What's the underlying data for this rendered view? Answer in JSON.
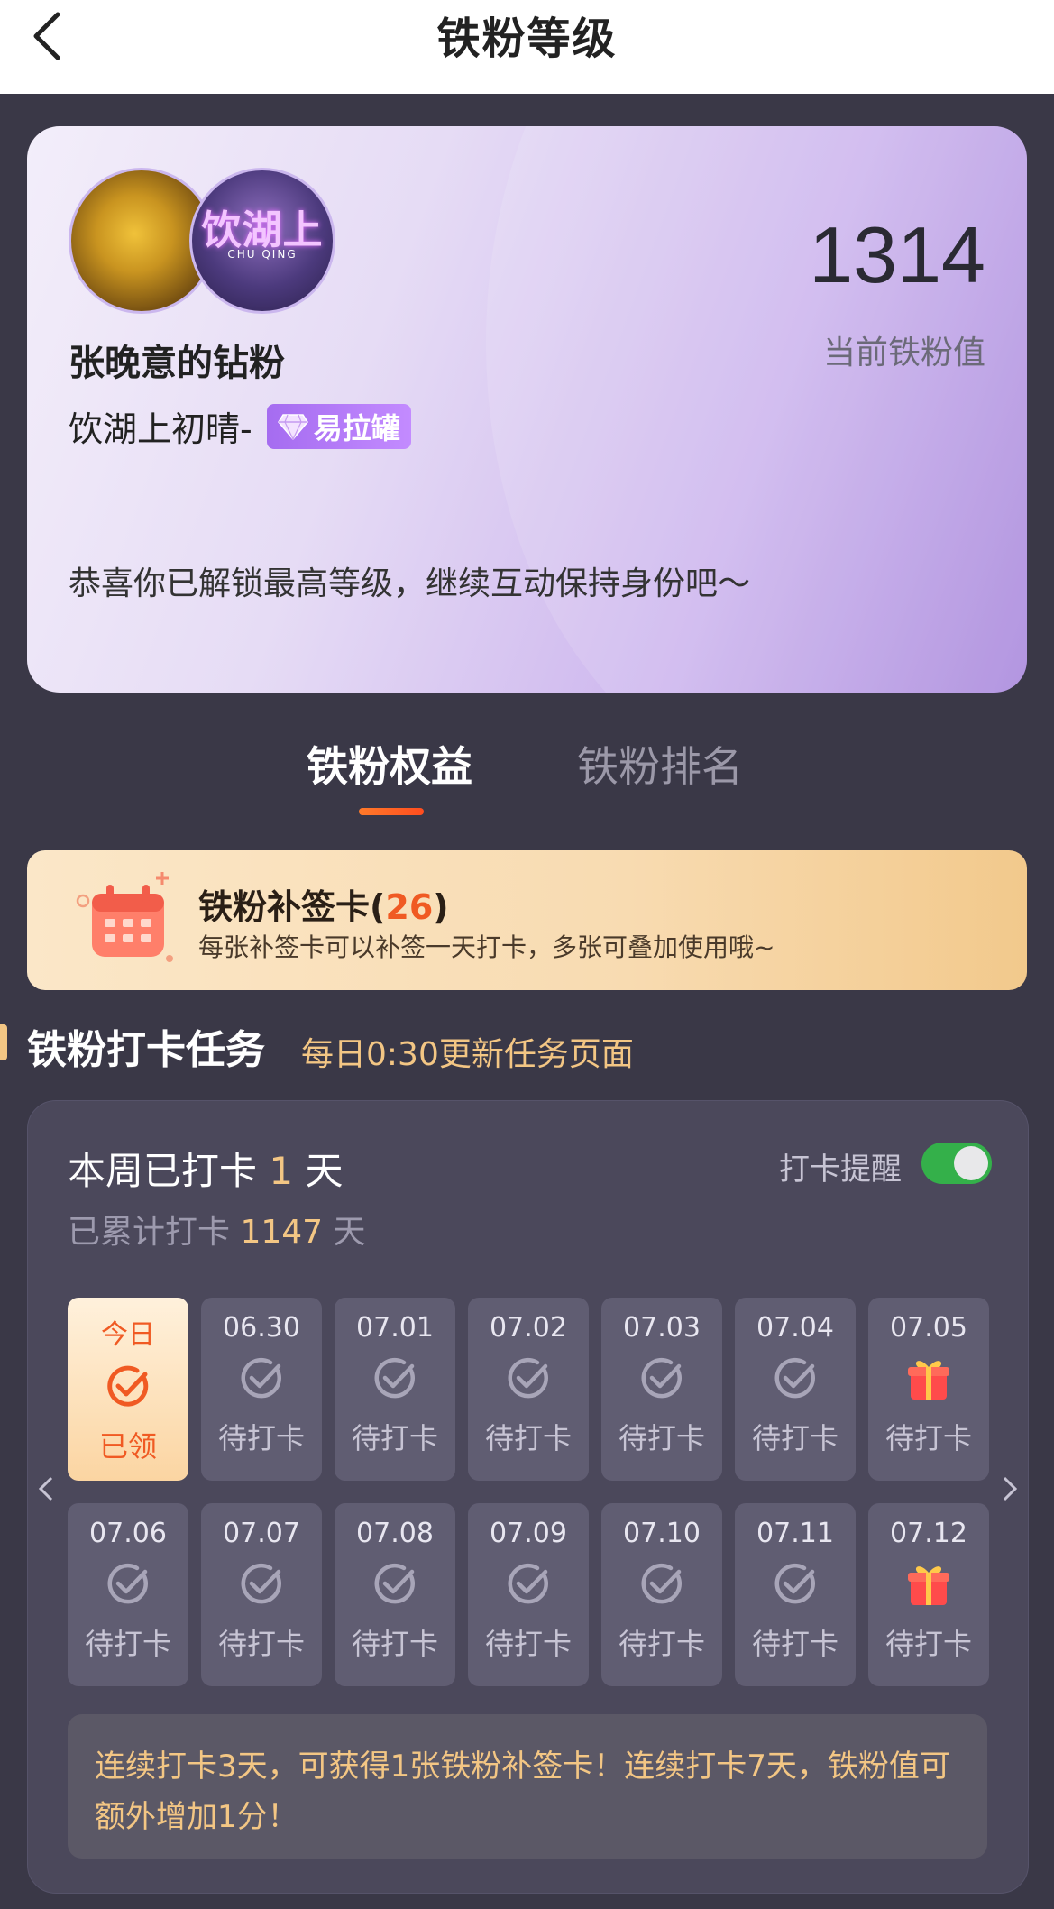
{
  "header": {
    "title": "铁粉等级"
  },
  "profile": {
    "fan_name": "张晚意的钻粉",
    "user_name": "饮湖上初晴-",
    "badge_label": "易拉罐",
    "congrats": "恭喜你已解锁最高等级，继续互动保持身份吧～",
    "fan_value": "1314",
    "fan_value_label": "当前铁粉值",
    "avatar2_text": "饮湖上",
    "avatar2_sub": "CHU QING"
  },
  "tabs": [
    {
      "label": "铁粉权益",
      "active": true
    },
    {
      "label": "铁粉排名",
      "active": false
    }
  ],
  "resign_card": {
    "title": "铁粉补签卡",
    "count": "26",
    "subtitle": "每张补签卡可以补签一天打卡，多张可叠加使用哦~"
  },
  "section": {
    "title": "铁粉打卡任务",
    "subtitle": "每日0:30更新任务页面"
  },
  "checkin": {
    "week_prefix": "本周已打卡",
    "week_days": "1",
    "week_suffix": "天",
    "total_prefix": "已累计打卡",
    "total_days": "1147",
    "total_suffix": "天",
    "remind_label": "打卡提醒",
    "remind_on": true,
    "days": [
      {
        "date": "今日",
        "status": "已领",
        "today": true
      },
      {
        "date": "06.30",
        "status": "待打卡",
        "icon": "check-icon"
      },
      {
        "date": "07.01",
        "status": "待打卡",
        "icon": "check-icon"
      },
      {
        "date": "07.02",
        "status": "待打卡",
        "icon": "check-icon"
      },
      {
        "date": "07.03",
        "status": "待打卡",
        "icon": "check-icon"
      },
      {
        "date": "07.04",
        "status": "待打卡",
        "icon": "check-icon"
      },
      {
        "date": "07.05",
        "status": "待打卡",
        "icon": "gift-icon"
      },
      {
        "date": "07.06",
        "status": "待打卡",
        "icon": "check-icon"
      },
      {
        "date": "07.07",
        "status": "待打卡",
        "icon": "check-icon"
      },
      {
        "date": "07.08",
        "status": "待打卡",
        "icon": "check-icon"
      },
      {
        "date": "07.09",
        "status": "待打卡",
        "icon": "check-icon"
      },
      {
        "date": "07.10",
        "status": "待打卡",
        "icon": "check-icon"
      },
      {
        "date": "07.11",
        "status": "待打卡",
        "icon": "check-icon"
      },
      {
        "date": "07.12",
        "status": "待打卡",
        "icon": "gift-icon"
      }
    ],
    "tip": "连续打卡3天，可获得1张铁粉补签卡！连续打卡7天，铁粉值可额外增加1分！"
  }
}
